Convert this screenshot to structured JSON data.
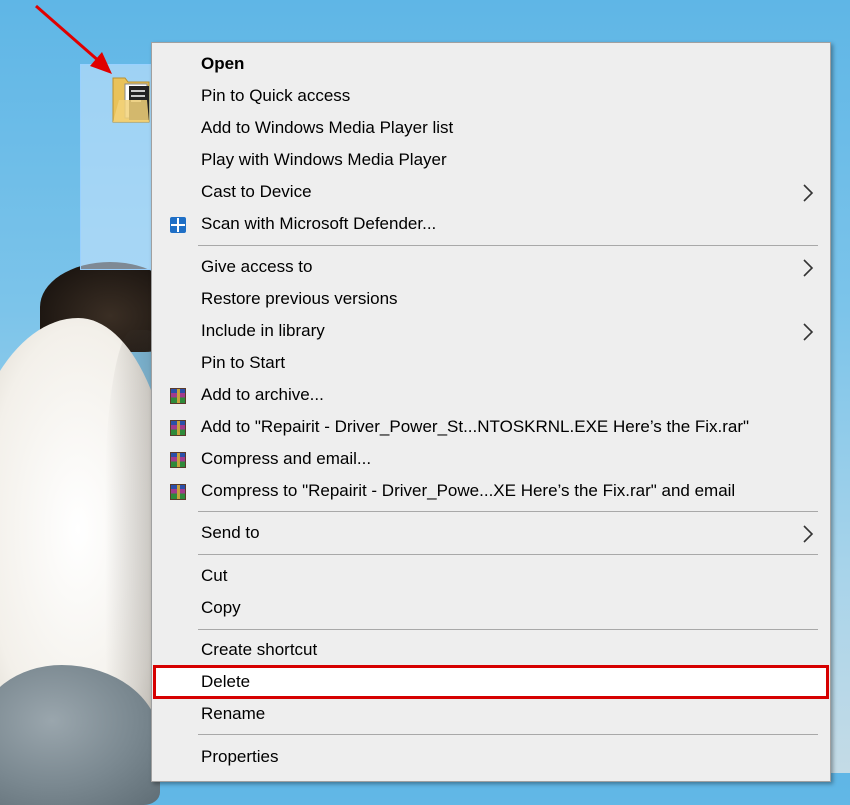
{
  "menu": {
    "items": [
      {
        "label": "Open",
        "bold": true
      },
      {
        "label": "Pin to Quick access"
      },
      {
        "label": "Add to Windows Media Player list"
      },
      {
        "label": "Play with Windows Media Player"
      },
      {
        "label": "Cast to Device",
        "submenu": true
      },
      {
        "label": "Scan with Microsoft Defender...",
        "icon": "shield-icon"
      },
      {
        "label": "Give access to",
        "submenu": true
      },
      {
        "label": "Restore previous versions"
      },
      {
        "label": "Include in library",
        "submenu": true
      },
      {
        "label": "Pin to Start"
      },
      {
        "label": "Add to archive...",
        "icon": "winrar-icon"
      },
      {
        "label": "Add to \"Repairit - Driver_Power_St...NTOSKRNL.EXE Here’s the Fix.rar\"",
        "icon": "winrar-icon"
      },
      {
        "label": "Compress and email...",
        "icon": "winrar-icon"
      },
      {
        "label": "Compress to \"Repairit - Driver_Powe...XE Here’s the Fix.rar\" and email",
        "icon": "winrar-icon"
      },
      {
        "label": "Send to",
        "submenu": true
      },
      {
        "label": "Cut"
      },
      {
        "label": "Copy"
      },
      {
        "label": "Create shortcut"
      },
      {
        "label": "Delete",
        "highlighted": true
      },
      {
        "label": "Rename"
      },
      {
        "label": "Properties"
      }
    ]
  },
  "colors": {
    "highlight_border": "#d60000",
    "arrow": "#e00000",
    "menu_background": "#eeeeee"
  }
}
